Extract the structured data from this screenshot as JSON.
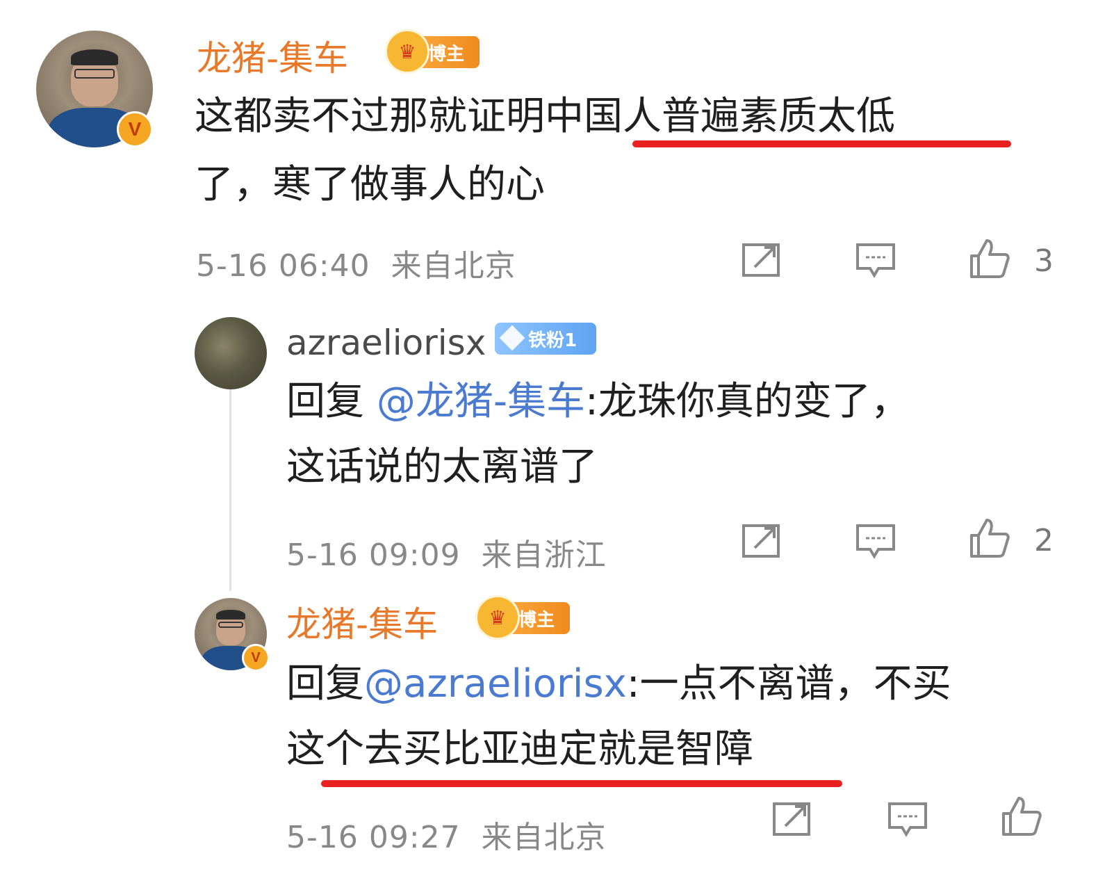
{
  "comments": [
    {
      "username": "龙猪-集车",
      "tag": "博主",
      "text_line1_part1": "这都卖不过那就证明中",
      "text_line1_part2": "国人普遍素质太低",
      "text_line2": "了，寒了做事人的心",
      "timestamp": "5-16 06:40",
      "location": "来自北京",
      "like_count": "3"
    },
    {
      "username": "azraeliorisx",
      "tag": "铁粉1",
      "reply_prefix": "回复 ",
      "mention": "@龙猪-集车",
      "text_line1": ":龙珠你真的变了，",
      "text_line2": "这话说的太离谱了",
      "timestamp": "5-16 09:09",
      "location": "来自浙江",
      "like_count": "2"
    },
    {
      "username": "龙猪-集车",
      "tag": "博主",
      "reply_prefix": "回复",
      "mention": "@azraeliorisx",
      "text_line1": ":一点不离谱，不买",
      "text_line2": "这个去买比亚迪定就是智障",
      "timestamp": "5-16 09:27",
      "location": "来自北京",
      "like_count": ""
    }
  ],
  "icons": {
    "share": "share-icon",
    "comment": "comment-icon",
    "like": "thumbs-up-icon",
    "verified": "verified-v-icon",
    "crown": "crown-icon",
    "diamond": "diamond-icon"
  },
  "colors": {
    "username_orange": "#e8792a",
    "mention_blue": "#4a7bd0",
    "underline_red": "#e82020",
    "meta_gray": "#888888"
  },
  "badge_letter": "V"
}
